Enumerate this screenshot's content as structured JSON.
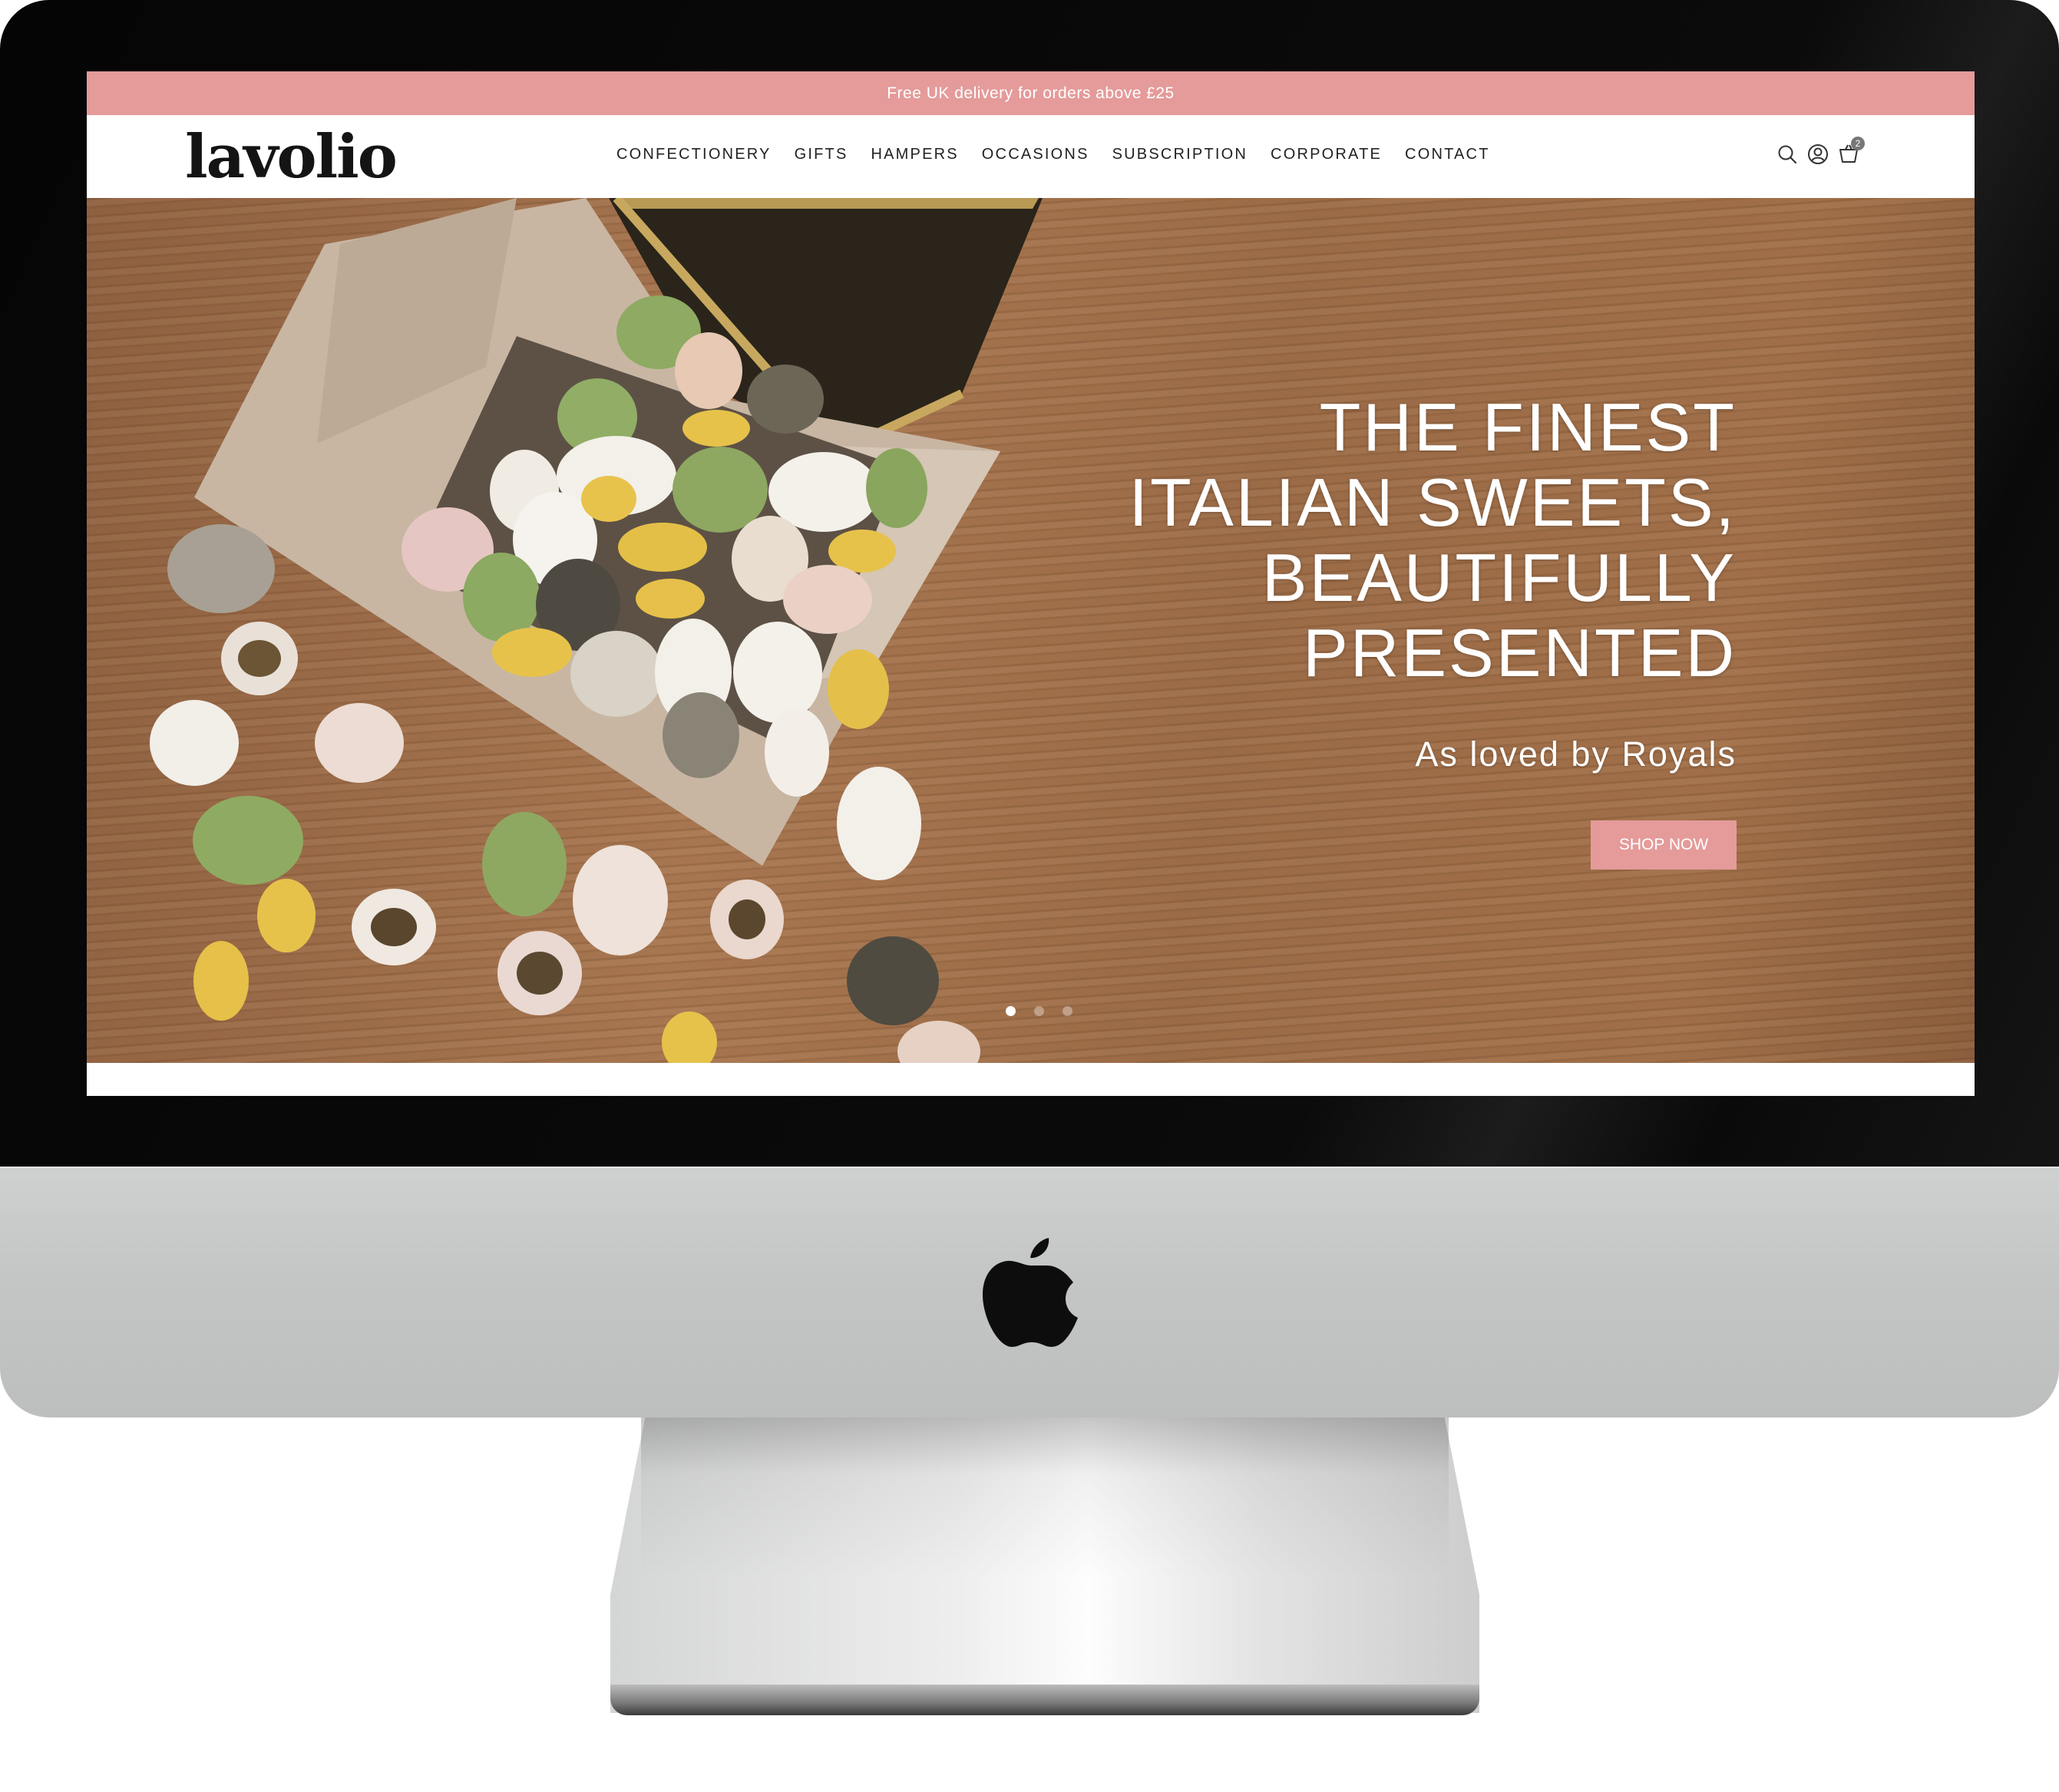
{
  "announcement": {
    "text": "Free UK delivery for orders above £25"
  },
  "brand": {
    "logo_text": "lavolio",
    "accent_color": "#e49b9a"
  },
  "nav": {
    "items": [
      {
        "label": "CONFECTIONERY"
      },
      {
        "label": "GIFTS"
      },
      {
        "label": "HAMPERS"
      },
      {
        "label": "OCCASIONS"
      },
      {
        "label": "SUBSCRIPTION"
      },
      {
        "label": "CORPORATE"
      },
      {
        "label": "CONTACT"
      }
    ]
  },
  "header_icons": {
    "search": "search-icon",
    "account": "account-icon",
    "cart": "cart-icon",
    "cart_count": "2"
  },
  "hero": {
    "headline_lines": [
      "THE FINEST",
      "ITALIAN SWEETS,",
      "BEAUTIFULLY",
      "PRESENTED"
    ],
    "subtitle": "As loved by Royals",
    "cta_label": "SHOP NOW",
    "slides": {
      "count": 3,
      "active": 1
    }
  }
}
